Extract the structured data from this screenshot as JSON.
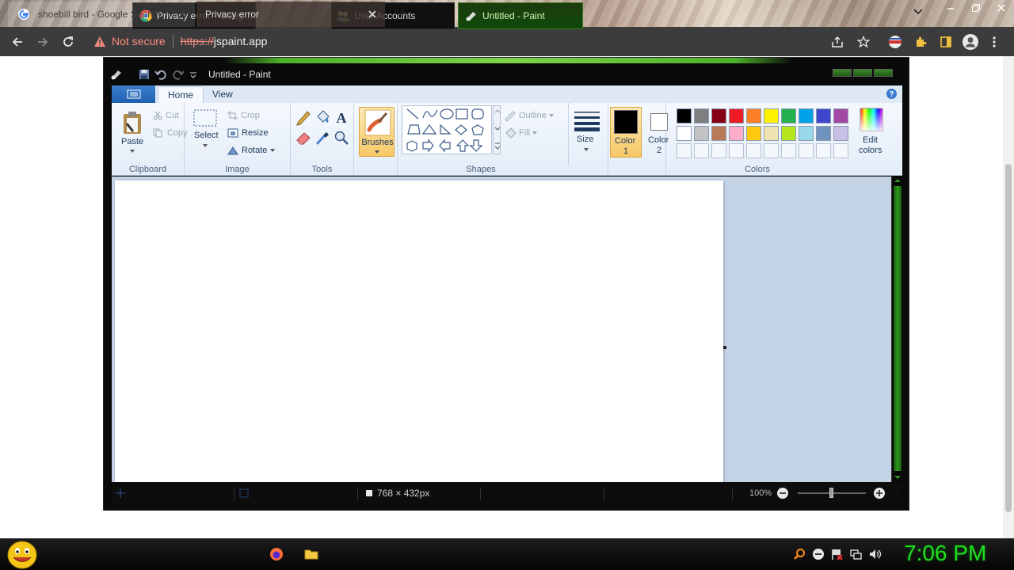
{
  "browser": {
    "tabs": [
      {
        "title": "shoebill bird - Google Search",
        "active": false
      },
      {
        "title": "Privacy error",
        "active": true
      }
    ],
    "security_label": "Not secure",
    "url_scheme": "https://",
    "url_host": "jspaint.app"
  },
  "paint": {
    "window_title": "Untitled - Paint",
    "ribbon_tabs": [
      "Home",
      "View"
    ],
    "clipboard": {
      "paste": "Paste",
      "cut": "Cut",
      "copy": "Copy",
      "group": "Clipboard"
    },
    "image": {
      "select": "Select",
      "crop": "Crop",
      "resize": "Resize",
      "rotate": "Rotate",
      "group": "Image"
    },
    "tools": {
      "group": "Tools"
    },
    "brushes": "Brushes",
    "shapes": {
      "outline": "Outline",
      "fill": "Fill",
      "group": "Shapes"
    },
    "size": "Size",
    "color1": {
      "line1": "Color",
      "line2": "1"
    },
    "color2": {
      "line1": "Color",
      "line2": "2"
    },
    "edit_colors": {
      "line1": "Edit",
      "line2": "colors"
    },
    "colors_group": "Colors",
    "palette_row1": [
      "#000000",
      "#7f7f7f",
      "#880015",
      "#ed1c24",
      "#ff7f27",
      "#fff200",
      "#22b14c",
      "#00a2e8",
      "#3f48cc",
      "#a349a4"
    ],
    "palette_row2": [
      "#ffffff",
      "#c3c3c3",
      "#b97a57",
      "#ffaec9",
      "#ffc90e",
      "#efe4b0",
      "#b5e61d",
      "#99d9ea",
      "#7092be",
      "#c8bfe7"
    ],
    "color1_value": "#000000",
    "color2_value": "#ffffff",
    "status_size": "768 × 432px",
    "zoom": "100%"
  },
  "taskbar": {
    "items": [
      {
        "label": "Privacy error - Googl..."
      },
      {
        "label": "User Accounts"
      },
      {
        "label": "Untitled - Paint"
      }
    ],
    "clock": "7:06 PM"
  }
}
